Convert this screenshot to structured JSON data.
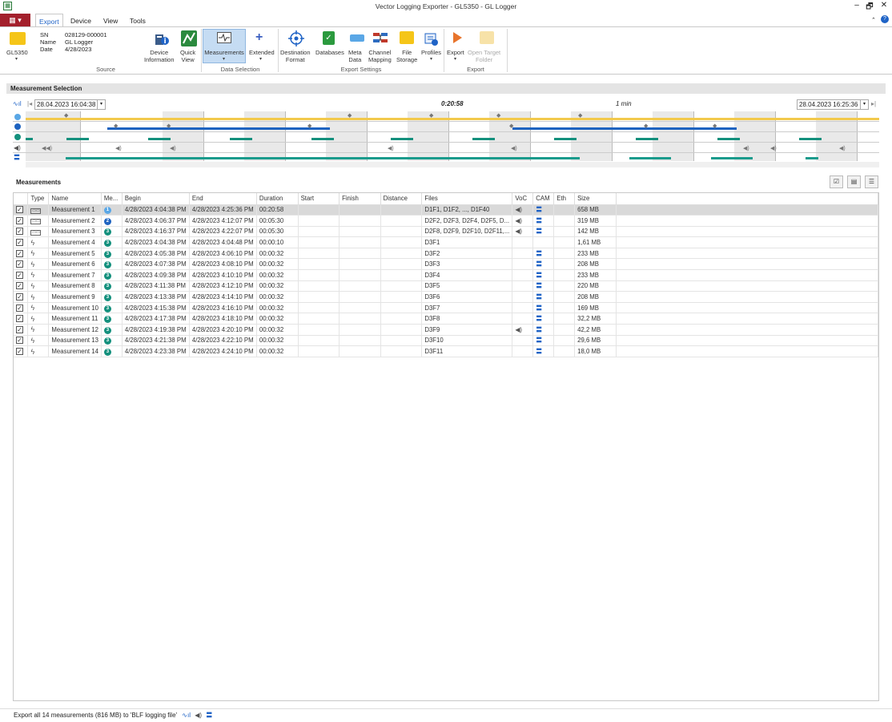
{
  "window": {
    "title": "Vector Logging Exporter - GL5350 - GL Logger",
    "min": "–",
    "restore": "🗗",
    "close": "✕",
    "help": "?"
  },
  "ribbon": {
    "file_label": "▦ ▾",
    "tabs": [
      "Export",
      "Device",
      "View",
      "Tools"
    ],
    "source": {
      "device_label": "GL5350",
      "sn_key": "SN",
      "sn_val": "028129-000001",
      "name_key": "Name",
      "name_val": "GL Logger",
      "date_key": "Date",
      "date_val": "4/28/2023",
      "device_info": "Device\nInformation",
      "quick_view": "Quick\nView",
      "group": "Source"
    },
    "data_selection": {
      "measurements": "Measurements",
      "extended": "Extended",
      "group": "Data Selection"
    },
    "export_settings": {
      "destination": "Destination\nFormat",
      "databases": "Databases",
      "meta": "Meta\nData",
      "channel": "Channel\nMapping",
      "file_storage": "File\nStorage",
      "profiles": "Profiles",
      "group": "Export Settings"
    },
    "export": {
      "export": "Export",
      "open_target": "Open Target\nFolder",
      "group": "Export"
    }
  },
  "selection": {
    "header": "Measurement Selection",
    "start": "28.04.2023 16:04:38",
    "end": "28.04.2023 16:25:36",
    "duration": "0:20:58",
    "scale": "1 min"
  },
  "measurements": {
    "title": "Measurements",
    "columns": [
      "",
      "Type",
      "Name",
      "Me...",
      "Begin",
      "End",
      "Duration",
      "Start",
      "Finish",
      "Distance",
      "Files",
      "VoC",
      "CAM",
      "Eth",
      "Size"
    ],
    "rows": [
      {
        "name": "Measurement 1",
        "me": "1",
        "begin": "4/28/2023 4:04:38 PM",
        "end": "4/28/2023 4:25:36 PM",
        "duration": "00:20:58",
        "files": "D1F1, D1F2, ..., D1F40",
        "voc": true,
        "cam": true,
        "size": "658 MB",
        "type": "box"
      },
      {
        "name": "Measurement 2",
        "me": "2",
        "begin": "4/28/2023 4:06:37 PM",
        "end": "4/28/2023 4:12:07 PM",
        "duration": "00:05:30",
        "files": "D2F2, D2F3, D2F4, D2F5, D...",
        "voc": true,
        "cam": true,
        "size": "319 MB",
        "type": "box"
      },
      {
        "name": "Measurement 3",
        "me": "3",
        "begin": "4/28/2023 4:16:37 PM",
        "end": "4/28/2023 4:22:07 PM",
        "duration": "00:05:30",
        "files": "D2F8, D2F9, D2F10, D2F11,...",
        "voc": true,
        "cam": true,
        "size": "142 MB",
        "type": "box"
      },
      {
        "name": "Measurement 4",
        "me": "3",
        "begin": "4/28/2023 4:04:38 PM",
        "end": "4/28/2023 4:04:48 PM",
        "duration": "00:00:10",
        "files": "D3F1",
        "voc": false,
        "cam": false,
        "size": "1,61 MB",
        "type": "bolt"
      },
      {
        "name": "Measurement 5",
        "me": "3",
        "begin": "4/28/2023 4:05:38 PM",
        "end": "4/28/2023 4:06:10 PM",
        "duration": "00:00:32",
        "files": "D3F2",
        "voc": false,
        "cam": true,
        "size": "233 MB",
        "type": "bolt"
      },
      {
        "name": "Measurement 6",
        "me": "3",
        "begin": "4/28/2023 4:07:38 PM",
        "end": "4/28/2023 4:08:10 PM",
        "duration": "00:00:32",
        "files": "D3F3",
        "voc": false,
        "cam": true,
        "size": "208 MB",
        "type": "bolt"
      },
      {
        "name": "Measurement 7",
        "me": "3",
        "begin": "4/28/2023 4:09:38 PM",
        "end": "4/28/2023 4:10:10 PM",
        "duration": "00:00:32",
        "files": "D3F4",
        "voc": false,
        "cam": true,
        "size": "233 MB",
        "type": "bolt"
      },
      {
        "name": "Measurement 8",
        "me": "3",
        "begin": "4/28/2023 4:11:38 PM",
        "end": "4/28/2023 4:12:10 PM",
        "duration": "00:00:32",
        "files": "D3F5",
        "voc": false,
        "cam": true,
        "size": "220 MB",
        "type": "bolt"
      },
      {
        "name": "Measurement 9",
        "me": "3",
        "begin": "4/28/2023 4:13:38 PM",
        "end": "4/28/2023 4:14:10 PM",
        "duration": "00:00:32",
        "files": "D3F6",
        "voc": false,
        "cam": true,
        "size": "208 MB",
        "type": "bolt"
      },
      {
        "name": "Measurement 10",
        "me": "3",
        "begin": "4/28/2023 4:15:38 PM",
        "end": "4/28/2023 4:16:10 PM",
        "duration": "00:00:32",
        "files": "D3F7",
        "voc": false,
        "cam": true,
        "size": "169 MB",
        "type": "bolt"
      },
      {
        "name": "Measurement 11",
        "me": "3",
        "begin": "4/28/2023 4:17:38 PM",
        "end": "4/28/2023 4:18:10 PM",
        "duration": "00:00:32",
        "files": "D3F8",
        "voc": false,
        "cam": true,
        "size": "32,2 MB",
        "type": "bolt"
      },
      {
        "name": "Measurement 12",
        "me": "3",
        "begin": "4/28/2023 4:19:38 PM",
        "end": "4/28/2023 4:20:10 PM",
        "duration": "00:00:32",
        "files": "D3F9",
        "voc": true,
        "cam": true,
        "size": "42,2 MB",
        "type": "bolt"
      },
      {
        "name": "Measurement 13",
        "me": "3",
        "begin": "4/28/2023 4:21:38 PM",
        "end": "4/28/2023 4:22:10 PM",
        "duration": "00:00:32",
        "files": "D3F10",
        "voc": false,
        "cam": true,
        "size": "29,6 MB",
        "type": "bolt"
      },
      {
        "name": "Measurement 14",
        "me": "3",
        "begin": "4/28/2023 4:23:38 PM",
        "end": "4/28/2023 4:24:10 PM",
        "duration": "00:00:32",
        "files": "D3F11",
        "voc": false,
        "cam": true,
        "size": "18,0 MB",
        "type": "bolt"
      }
    ]
  },
  "status": {
    "text": "Export all 14 measurements (816 MB) to 'BLF logging file'"
  },
  "colors": {
    "accent": "#1f63c6",
    "file_tab": "#a3202c",
    "yellow": "#f2c94c",
    "blue": "#1e63c0",
    "teal": "#1a9b8c",
    "circle1": "#5aa7e6",
    "circle2": "#1e63c0",
    "circle3": "#14907d"
  }
}
